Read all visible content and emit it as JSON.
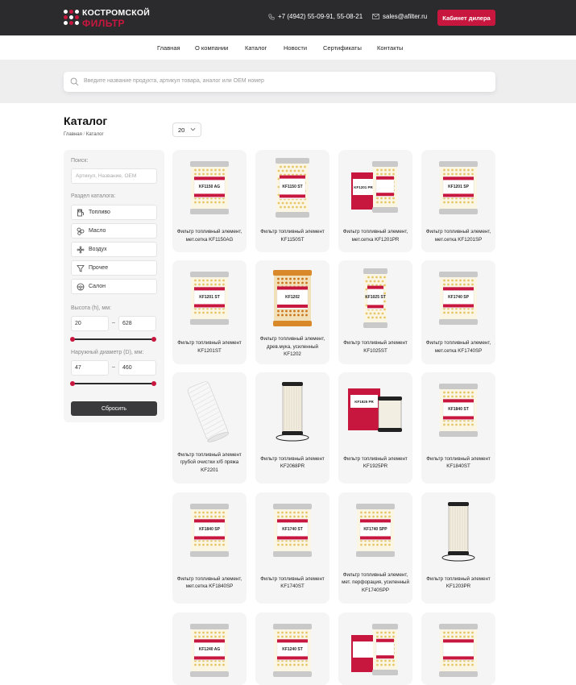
{
  "header": {
    "logo_line1": "КОСТРОМСКОЙ",
    "logo_line2": "ФИЛЬТР",
    "phone": "+7 (4942) 55-09-91, 55-08-21",
    "email": "sales@afilter.ru",
    "dealer_button": "Кабинет дилера",
    "accent_color": "#c8173f"
  },
  "nav": {
    "items": [
      "Главная",
      "О компании",
      "Каталог",
      "Новости",
      "Сертификаты",
      "Контакты"
    ]
  },
  "search": {
    "placeholder": "Введите название продукта, артикул товара, аналог или OEM номер"
  },
  "page": {
    "title": "Каталог",
    "breadcrumb": [
      "Главная",
      "Каталог"
    ],
    "per_page": "20"
  },
  "sidebar": {
    "search_label": "Поиск:",
    "search_placeholder": "Артикул, Название, OEM",
    "section_label": "Раздел каталога:",
    "categories": [
      {
        "label": "Топливо",
        "icon": "fuel-icon"
      },
      {
        "label": "Масло",
        "icon": "oil-icon"
      },
      {
        "label": "Воздух",
        "icon": "air-icon"
      },
      {
        "label": "Прочее",
        "icon": "funnel-icon"
      },
      {
        "label": "Салон",
        "icon": "steering-wheel-icon"
      }
    ],
    "height_label": "Высота (h), мм:",
    "height_min": "20",
    "height_max": "628",
    "diameter_label": "Наружный диаметр (D), мм:",
    "diameter_min": "47",
    "diameter_max": "460",
    "reset_button": "Сбросить"
  },
  "products": [
    {
      "name": "Фильтр топливный элемент, мет.сетка KF1150AG",
      "kind": "paper",
      "label": "KF1150 AG"
    },
    {
      "name": "Фильтр топливный элемент KF1150ST",
      "kind": "paper-tall",
      "label": "KF1150 ST"
    },
    {
      "name": "Фильтр топливный элемент, мет.сетка KF1201PR",
      "kind": "boxed",
      "label": "KF1201 PR"
    },
    {
      "name": "Фильтр топливный элемент, мет.сетка KF1201SP",
      "kind": "paper",
      "label": "KF1201 SP"
    },
    {
      "name": "Фильтр топливный элемент KF1201ST",
      "kind": "paper",
      "label": "KF1201 ST"
    },
    {
      "name": "Фильтр топливный элемент, древ.мука, усиленный KF1202",
      "kind": "orange",
      "label": "KF1202"
    },
    {
      "name": "Фильтр топливный элемент KF1025ST",
      "kind": "paper-slim",
      "label": "KF1025 ST"
    },
    {
      "name": "Фильтр топливный элемент, мет.сетка KF1740SP",
      "kind": "paper",
      "label": "KF1740 SP"
    },
    {
      "name": "Фильтр топливный элемент грубой очистки х/б пряжа KF2201",
      "kind": "yarn",
      "label": "KF2201"
    },
    {
      "name": "Фильтр топливный элемент KF2068PR",
      "kind": "pleated",
      "label": "KF2068 PR"
    },
    {
      "name": "Фильтр топливный элемент KF1925PR",
      "kind": "boxed-pleated",
      "label": "KF1925 PR"
    },
    {
      "name": "Фильтр топливный элемент KF1840ST",
      "kind": "paper",
      "label": "KF1840 ST"
    },
    {
      "name": "Фильтр топливный элемент, мет.сетка KF1840SP",
      "kind": "paper",
      "label": "KF1840 SP"
    },
    {
      "name": "Фильтр топливный элемент KF1740ST",
      "kind": "paper",
      "label": "KF1740 ST"
    },
    {
      "name": "Фильтр топливный элемент, мет. перфорация, усиленный KF1740SPP",
      "kind": "paper",
      "label": "KF1740 SPP"
    },
    {
      "name": "Фильтр топливный элемент KF1203PR",
      "kind": "pleated",
      "label": "KF1203 PR"
    },
    {
      "name": "",
      "kind": "paper",
      "label": "KF1240 AG"
    },
    {
      "name": "",
      "kind": "paper",
      "label": "KF1240 ST"
    },
    {
      "name": "",
      "kind": "boxed",
      "label": ""
    },
    {
      "name": "",
      "kind": "paper",
      "label": ""
    }
  ]
}
